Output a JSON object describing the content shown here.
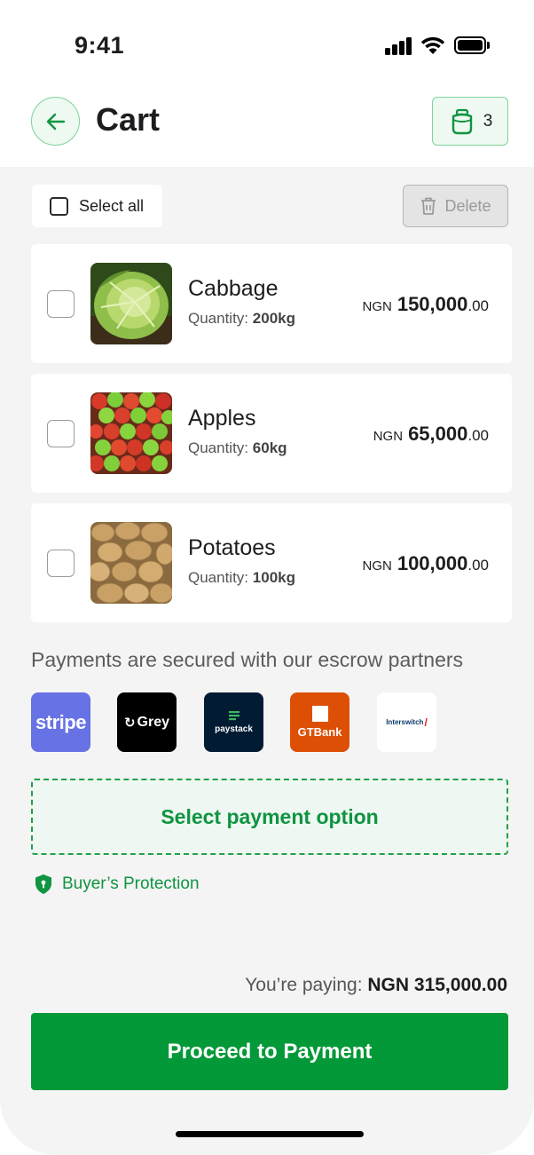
{
  "status_bar": {
    "time": "9:41"
  },
  "header": {
    "title": "Cart",
    "basket_count": "3"
  },
  "toolbar": {
    "select_all_label": "Select all",
    "delete_label": "Delete"
  },
  "items": [
    {
      "name": "Cabbage",
      "quantity_label": "Quantity:",
      "quantity_value": "200kg",
      "currency": "NGN",
      "amount": "150,000",
      "decimals": ".00",
      "image": "cabbage"
    },
    {
      "name": "Apples",
      "quantity_label": "Quantity:",
      "quantity_value": "60kg",
      "currency": "NGN",
      "amount": "65,000",
      "decimals": ".00",
      "image": "apples"
    },
    {
      "name": "Potatoes",
      "quantity_label": "Quantity:",
      "quantity_value": "100kg",
      "currency": "NGN",
      "amount": "100,000",
      "decimals": ".00",
      "image": "potatoes"
    }
  ],
  "escrow": {
    "text": "Payments are secured with our escrow partners",
    "partners": [
      {
        "name": "stripe",
        "color": "#6772e5"
      },
      {
        "name": "Grey",
        "color": "#000000"
      },
      {
        "name": "paystack",
        "color": "#011b33"
      },
      {
        "name": "GTBank",
        "color": "#dd4f05"
      },
      {
        "name": "Interswitch",
        "color": "#ffffff"
      }
    ]
  },
  "payment_option_label": "Select payment option",
  "buyers_protection_label": "Buyer’s Protection",
  "summary": {
    "label": "You’re paying:",
    "total": "NGN 315,000.00"
  },
  "proceed_label": "Proceed to Payment",
  "colors": {
    "accent": "#049938",
    "accent_text": "#0f9440",
    "background": "#f4f4f4"
  }
}
